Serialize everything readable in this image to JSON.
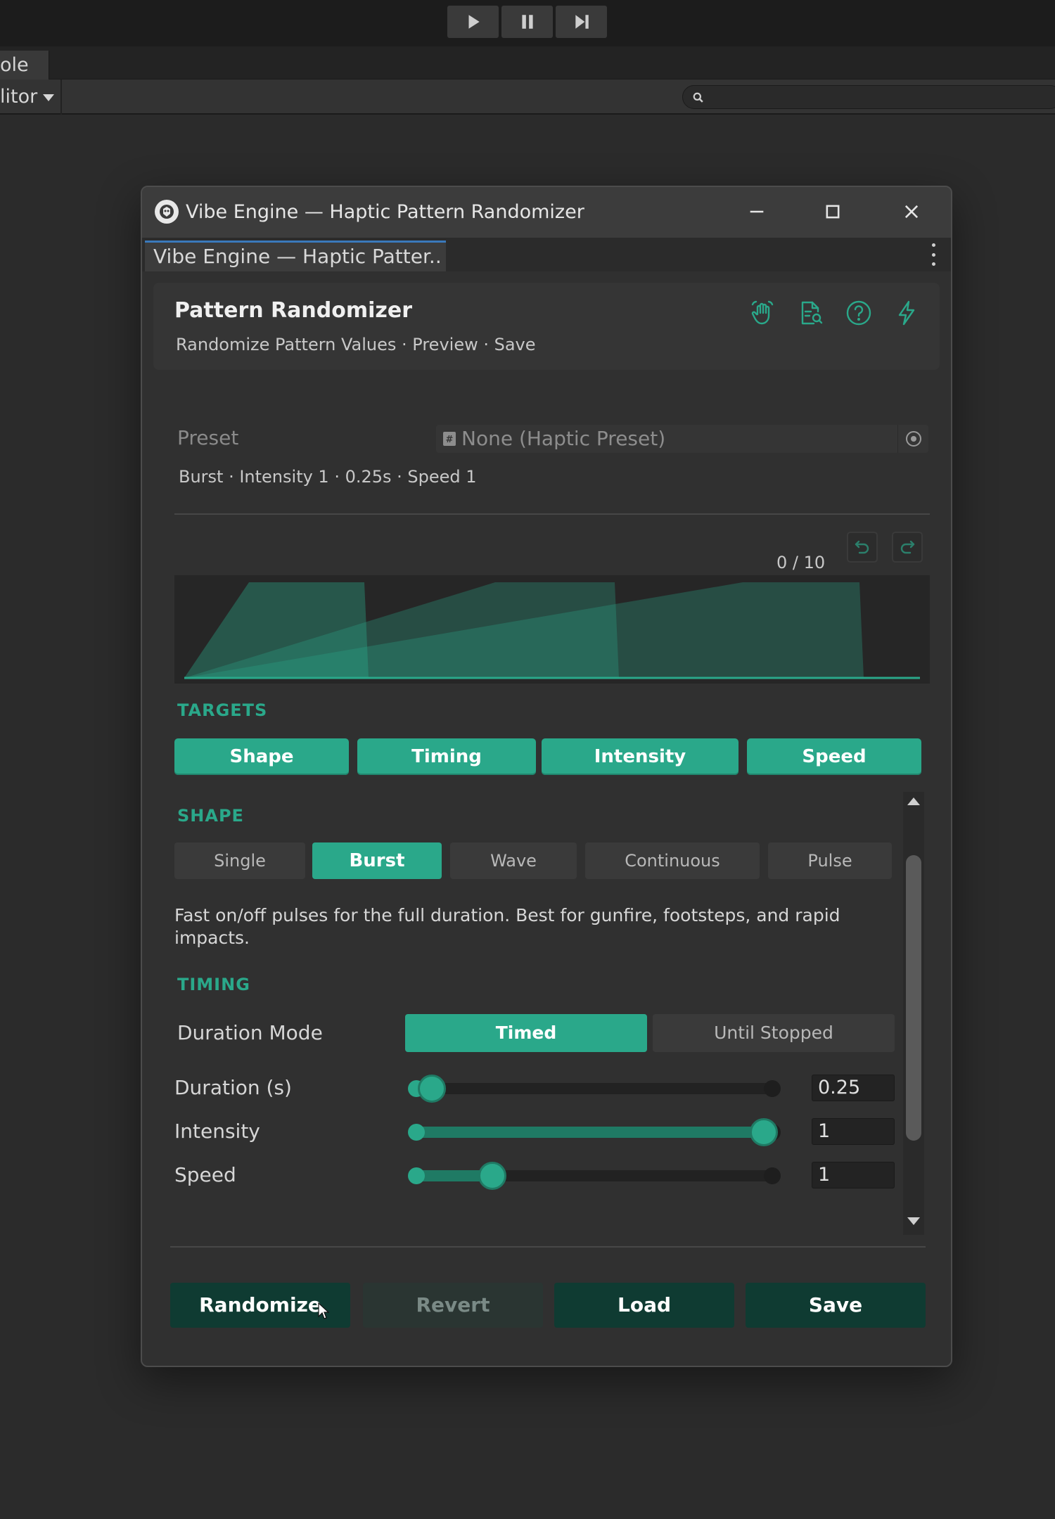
{
  "toolbar": {
    "console_tab": "ole",
    "editor_dropdown": "litor"
  },
  "window": {
    "title": "Vibe Engine — Haptic Pattern Randomizer",
    "tab_label": "Vibe Engine — Haptic Patter.."
  },
  "header": {
    "title": "Pattern Randomizer",
    "subtitle": "Randomize Pattern Values · Preview · Save",
    "icons": [
      "hand-icon",
      "inspect-document-icon",
      "help-icon",
      "lightning-icon"
    ]
  },
  "preset": {
    "label": "Preset",
    "value": "None (Haptic Preset)",
    "summary": "Burst · Intensity 1 · 0.25s · Speed 1"
  },
  "history": {
    "count": "0 / 10"
  },
  "targets": {
    "title": "TARGETS",
    "buttons": [
      "Shape",
      "Timing",
      "Intensity",
      "Speed"
    ]
  },
  "shape": {
    "title": "SHAPE",
    "options": [
      "Single",
      "Burst",
      "Wave",
      "Continuous",
      "Pulse"
    ],
    "selected": "Burst",
    "description": "Fast on/off pulses for the full duration. Best for gunfire, footsteps, and rapid impacts."
  },
  "timing": {
    "title": "TIMING",
    "duration_mode_label": "Duration Mode",
    "modes": [
      "Timed",
      "Until Stopped"
    ],
    "selected_mode": "Timed",
    "duration": {
      "label": "Duration (s)",
      "value": "0.25",
      "fraction": 0.02
    },
    "intensity": {
      "label": "Intensity",
      "value": "1",
      "fraction": 1.0
    },
    "speed": {
      "label": "Speed",
      "value": "1",
      "fraction": 0.2
    }
  },
  "actions": {
    "randomize": "Randomize",
    "revert": "Revert",
    "load": "Load",
    "save": "Save"
  },
  "colors": {
    "accent": "#2aa88a",
    "accent_dark": "#0f3b32",
    "window_bg": "#303030"
  }
}
